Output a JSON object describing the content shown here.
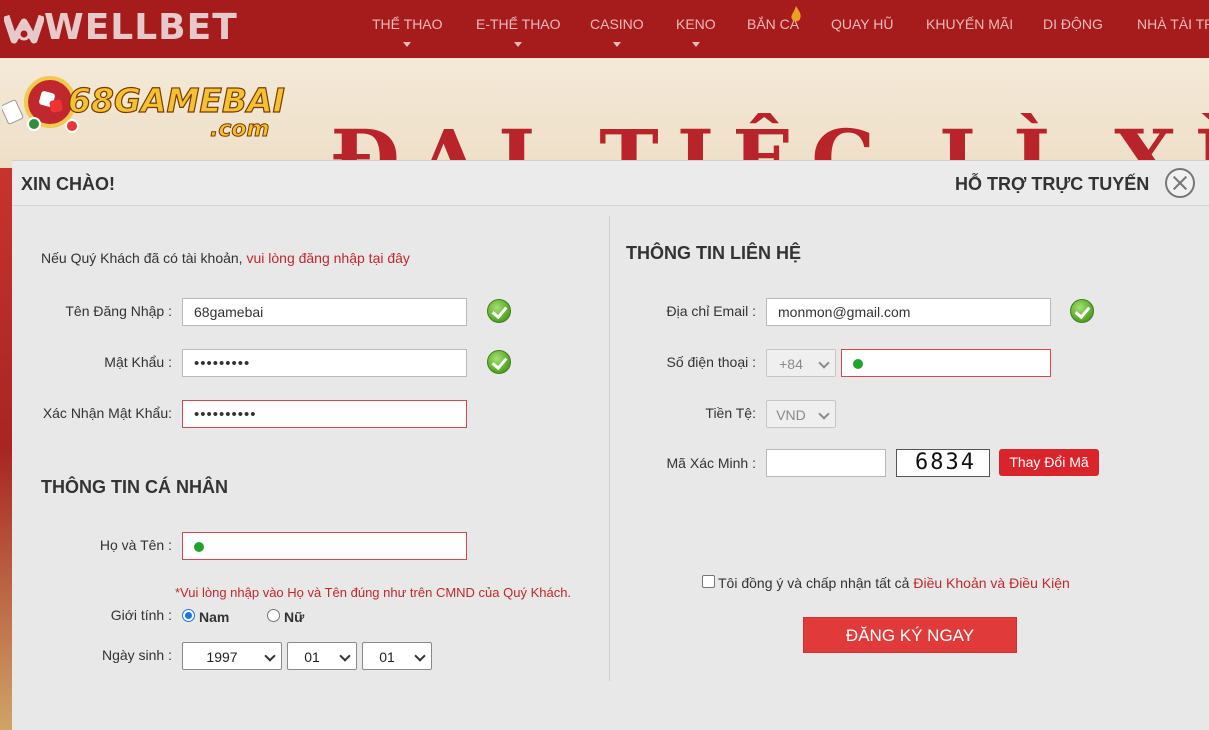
{
  "brand": {
    "name": "WELLBET"
  },
  "nav": {
    "items": [
      {
        "label": "THỂ THAO",
        "caret": true
      },
      {
        "label": "E-THỂ THAO",
        "caret": true
      },
      {
        "label": "CASINO",
        "caret": true
      },
      {
        "label": "KENO",
        "caret": true
      },
      {
        "label": "BẮN CÁ",
        "caret": false
      },
      {
        "label": "QUAY HŨ",
        "caret": false
      },
      {
        "label": "KHUYẾN MÃI",
        "caret": false
      },
      {
        "label": "DI ĐỘNG",
        "caret": false
      },
      {
        "label": "NHÀ TÀI TRỢ",
        "caret": false
      }
    ]
  },
  "banner": {
    "logo_text": "68GAMEBAI",
    "logo_sub": ".com",
    "title": "ĐẠI TIỆC LÌ XÌ"
  },
  "modal": {
    "greeting": "XIN CHÀO!",
    "support": "HỖ TRỢ TRỰC TUYẾN",
    "login_prompt": "Nếu Quý Khách đã có tài khoản,",
    "login_link": "vui lòng đăng nhập tại đây",
    "account": {
      "username_label": "Tên Đăng Nhập :",
      "username_value": "68gamebai",
      "password_label": "Mật Khẩu :",
      "password_value": "•••••••••",
      "confirm_label": "Xác Nhận Mật Khẩu:",
      "confirm_value": "••••••••••"
    },
    "personal": {
      "title": "THÔNG TIN CÁ NHÂN",
      "fullname_label": "Họ và Tên :",
      "fullname_hint": "*Vui lòng nhập vào Họ và Tên đúng như trên CMND của Quý Khách.",
      "gender_label": "Giới tính :",
      "gender_male": "Nam",
      "gender_female": "Nữ",
      "gender_selected": "Nam",
      "dob_label": "Ngày sinh :",
      "dob_year": "1997",
      "dob_month": "01",
      "dob_day": "01"
    },
    "contact": {
      "title": "THÔNG TIN LIÊN HỆ",
      "email_label": "Địa chỉ Email :",
      "email_value": "monmon@gmail.com",
      "phone_label": "Số điện thoại :",
      "phone_code": "+84",
      "currency_label": "Tiền Tệ:",
      "currency_value": "VND",
      "captcha_label": "Mã Xác Minh :",
      "captcha_image_text": "6834",
      "captcha_refresh": "Thay Đổi Mã"
    },
    "terms": {
      "text": "Tôi đồng ý và chấp nhận tất cả",
      "link": "Điều Khoản và Điều Kiện",
      "checked": false
    },
    "submit": "ĐĂNG KÝ NGAY"
  }
}
